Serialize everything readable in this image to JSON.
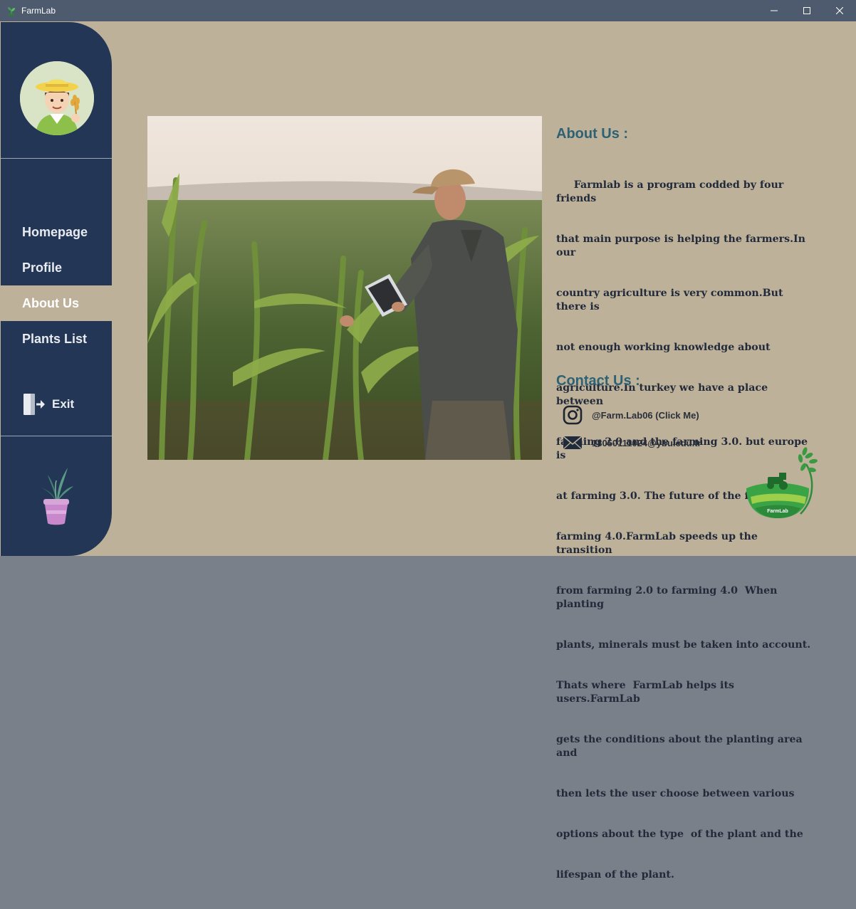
{
  "window": {
    "title": "FarmLab"
  },
  "sidebar": {
    "items": [
      {
        "label": "Homepage"
      },
      {
        "label": "Profile"
      },
      {
        "label": "About Us"
      },
      {
        "label": "Plants List"
      }
    ],
    "exit_label": "Exit"
  },
  "about": {
    "title": "About Us :",
    "lines": [
      "     Farmlab is a program codded by four friends",
      "that main purpose is helping the farmers.In our",
      "country agriculture is very common.But  there is",
      "not enough working knowledge about",
      "agriculture.In turkey we have a place between",
      "farming 2.0 and the farming 3.0. but europe is",
      "at farming 3.0. The future of the farming is",
      "farming 4.0.FarmLab speeds up the transition",
      "from farming 2.0 to farming 4.0  When planting",
      "plants, minerals must be taken into account.",
      "Thats where  FarmLab helps its users.FarmLab",
      "gets the conditions about the planting area and",
      "then lets the user choose between various",
      "options about the type  of the plant and the",
      "lifespan of the plant."
    ]
  },
  "contact": {
    "title": "Contact Us :",
    "instagram": "@Farm.Lab06  (Click Me)",
    "email": "18050111024@ybu.edu.tr"
  },
  "logo_text": "FarmLab",
  "colors": {
    "sidebar": "#233656",
    "background": "#bdb19a",
    "heading": "#2d6173",
    "active": "#bdb19a"
  }
}
